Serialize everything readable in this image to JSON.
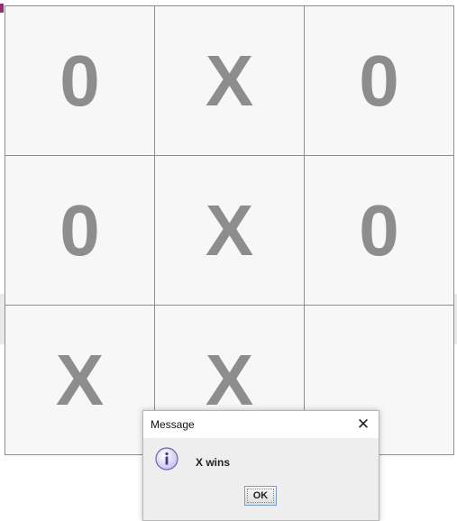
{
  "board": {
    "cells": [
      "0",
      "X",
      "0",
      "0",
      "X",
      "0",
      "X",
      "X",
      ""
    ]
  },
  "dialog": {
    "title": "Message",
    "message": "X wins",
    "ok_label": "OK",
    "close_glyph": "✕",
    "icon": "info-icon"
  },
  "colors": {
    "mark": "#8d8d8d",
    "cell_border": "#8e8e8e",
    "dialog_bg": "#eeeeee"
  }
}
